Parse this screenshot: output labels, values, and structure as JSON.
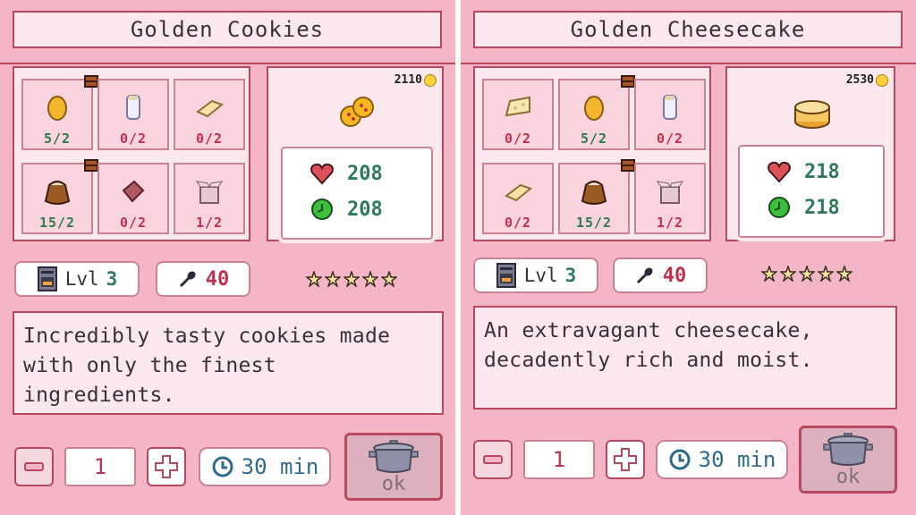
{
  "colors": {
    "background": "#f4b6c6",
    "frame": "#b8485f",
    "ok_count": "#2f7a4c",
    "missing_count": "#c0314f",
    "coin": "#ffd23c"
  },
  "panels": [
    {
      "title": "Golden Cookies",
      "price": "2110",
      "dish_icon": "golden-cookies-icon",
      "health": "208",
      "energy": "208",
      "level_label": "Lvl",
      "level_value": "3",
      "xp": "40",
      "stars": 5,
      "description": "Incredibly tasty cookies made with only the finest ingredients.",
      "quantity": "1",
      "time": "30 min",
      "ok_label": "ok",
      "ingredients": [
        {
          "icon": "egg-icon",
          "count": "5/2",
          "status": "ok",
          "badge": true
        },
        {
          "icon": "milk-bottle-icon",
          "count": "0/2",
          "status": "missing",
          "badge": false
        },
        {
          "icon": "butter-icon",
          "count": "0/2",
          "status": "missing",
          "badge": false
        },
        {
          "icon": "flour-sack-icon",
          "count": "15/2",
          "status": "ok",
          "badge": true
        },
        {
          "icon": "chocolate-bar-icon",
          "count": "0/2",
          "status": "missing",
          "badge": false
        },
        {
          "icon": "sugar-box-icon",
          "count": "1/2",
          "status": "missing",
          "badge": false
        }
      ]
    },
    {
      "title": "Golden Cheesecake",
      "price": "2530",
      "dish_icon": "golden-cheesecake-icon",
      "health": "218",
      "energy": "218",
      "level_label": "Lvl",
      "level_value": "3",
      "xp": "40",
      "stars": 5,
      "description": "An extravagant cheesecake, decadently rich and moist.",
      "quantity": "1",
      "time": "30 min",
      "ok_label": "ok",
      "ingredients": [
        {
          "icon": "cheese-icon",
          "count": "0/2",
          "status": "missing",
          "badge": false
        },
        {
          "icon": "egg-icon",
          "count": "5/2",
          "status": "ok",
          "badge": true
        },
        {
          "icon": "milk-bottle-icon",
          "count": "0/2",
          "status": "missing",
          "badge": false
        },
        {
          "icon": "butter-icon",
          "count": "0/2",
          "status": "missing",
          "badge": false
        },
        {
          "icon": "flour-sack-icon",
          "count": "15/2",
          "status": "ok",
          "badge": true
        },
        {
          "icon": "sugar-box-icon",
          "count": "1/2",
          "status": "missing",
          "badge": false
        }
      ]
    }
  ]
}
